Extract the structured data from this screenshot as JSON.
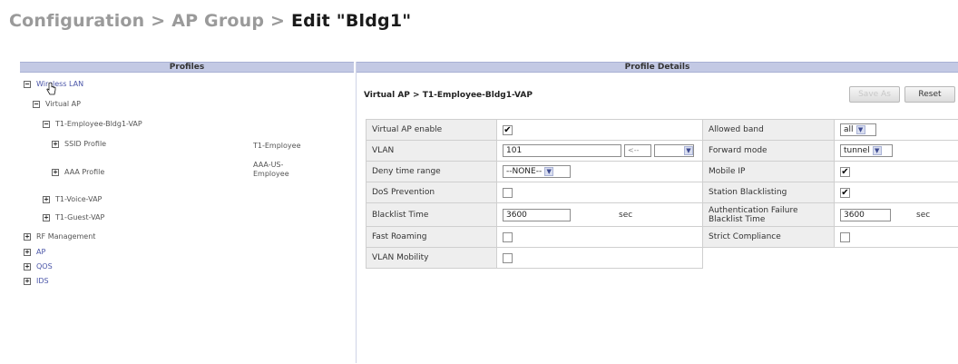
{
  "breadcrumb": {
    "configuration": "Configuration",
    "sep1": ">",
    "ap_group": "AP Group",
    "sep2": ">",
    "current": "Edit \"Bldg1\""
  },
  "profiles_panel": {
    "header": "Profiles",
    "wireless_lan": {
      "expander": "−",
      "label": "Wireless LAN"
    },
    "virtual_ap": {
      "expander": "−",
      "label": "Virtual AP"
    },
    "employee_vap": {
      "expander": "−",
      "label": "T1-Employee-Bldg1-VAP"
    },
    "ssid_profile": {
      "expander": "+",
      "label": "SSID Profile",
      "value": "T1-Employee"
    },
    "aaa_profile": {
      "expander": "+",
      "label": "AAA Profile",
      "value_line1": "AAA-US-",
      "value_line2": "Employee"
    },
    "voice_vap": {
      "expander": "+",
      "label": "T1-Voice-VAP"
    },
    "guest_vap": {
      "expander": "+",
      "label": "T1-Guest-VAP"
    },
    "rf_management": {
      "expander": "+",
      "label": "RF Management"
    },
    "ap": {
      "expander": "+",
      "label": "AP"
    },
    "qos": {
      "expander": "+",
      "label": "QOS"
    },
    "ids": {
      "expander": "+",
      "label": "IDS"
    }
  },
  "details_panel": {
    "header": "Profile Details",
    "title": "Virtual AP > T1-Employee-Bldg1-VAP",
    "save_label": "Save As",
    "reset_label": "Reset",
    "fields": {
      "virtual_ap_enable": {
        "label": "Virtual AP enable",
        "checked": "✔"
      },
      "allowed_band": {
        "label": "Allowed band",
        "value": "all"
      },
      "vlan": {
        "label": "VLAN",
        "value": "101",
        "arrow": "<--"
      },
      "forward_mode": {
        "label": "Forward mode",
        "value": "tunnel"
      },
      "deny_time_range": {
        "label": "Deny time range",
        "value": "--NONE--"
      },
      "mobile_ip": {
        "label": "Mobile IP",
        "checked": "✔"
      },
      "dos_prevention": {
        "label": "DoS Prevention",
        "checked": ""
      },
      "station_blacklisting": {
        "label": "Station Blacklisting",
        "checked": "✔"
      },
      "blacklist_time": {
        "label": "Blacklist Time",
        "value": "3600",
        "unit": "sec"
      },
      "auth_failure_blacklist_time": {
        "label_line1": "Authentication Failure",
        "label_line2": "Blacklist Time",
        "value": "3600",
        "unit": "sec"
      },
      "fast_roaming": {
        "label": "Fast Roaming",
        "checked": ""
      },
      "strict_compliance": {
        "label": "Strict Compliance",
        "checked": ""
      },
      "vlan_mobility": {
        "label": "VLAN Mobility",
        "checked": ""
      }
    }
  },
  "icons": {
    "dropdown": "chevron-down-icon",
    "expand": "plus-icon",
    "collapse": "minus-icon",
    "cursor": "hand-cursor-icon"
  },
  "colors": {
    "header_band": "#c3c9e4",
    "link": "#4a55a8",
    "label_cell": "#eeeeee",
    "dropdown_btn": "#d9deef"
  }
}
